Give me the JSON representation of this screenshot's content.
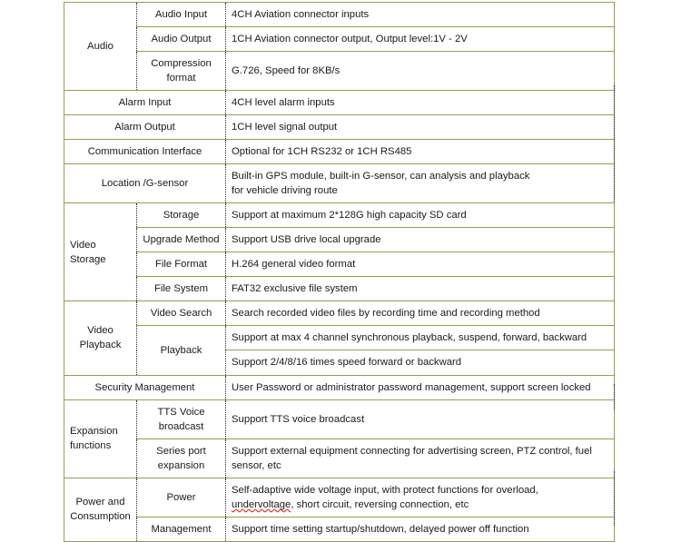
{
  "document": {
    "title": "Device Specification Table",
    "type": "specification-table"
  },
  "table": {
    "border_color": "#9a9a5e",
    "divider_color": "#2b2b2b",
    "columns": 3,
    "rows": [
      {
        "id": "audio",
        "category": "Audio",
        "category_rowspan": 3,
        "subitems": [
          {
            "label": "Audio Input",
            "value": "4CH Aviation connector inputs"
          },
          {
            "label": "Audio Output",
            "value": "1CH Aviation connector output, Output level:1V - 2V"
          },
          {
            "label": "Compression format",
            "value": "G.726, Speed for 8KB/s"
          }
        ]
      },
      {
        "id": "alarm-input",
        "category": "Alarm Input",
        "merged": true,
        "value": "4CH level alarm inputs"
      },
      {
        "id": "alarm-output",
        "category": "Alarm Output",
        "merged": true,
        "value": "1CH level signal output"
      },
      {
        "id": "communication-interface",
        "category": "Communication Interface",
        "merged": true,
        "value": "Optional for 1CH RS232 or 1CH RS485"
      },
      {
        "id": "location-gsensor",
        "category": "Location /G-sensor",
        "merged": true,
        "value_line1": "Built-in GPS module, built-in G-sensor, can analysis and playback",
        "value_line2": "for vehicle driving route"
      },
      {
        "id": "video-storage",
        "category": "Video Storage",
        "category_rowspan": 4,
        "subitems": [
          {
            "label": "Storage",
            "value": "Support at maximum 2*128G high capacity SD card"
          },
          {
            "label": "Upgrade Method",
            "value": "Support USB drive local upgrade"
          },
          {
            "label": "File Format",
            "value": "H.264 general video format"
          },
          {
            "label": "File System",
            "value": "FAT32 exclusive file system"
          }
        ]
      },
      {
        "id": "video-playback",
        "category": "Video Playback",
        "category_rowspan": 3,
        "subitems": [
          {
            "label": "Video Search",
            "value": "Search recorded video files by recording time and recording method"
          },
          {
            "label": "Playback",
            "value": "Support at max 4 channel synchronous playback, suspend, forward, backward"
          },
          {
            "label": "",
            "value": "Support 2/4/8/16 times speed forward or backward"
          }
        ]
      },
      {
        "id": "security-management",
        "category": "Security Management",
        "merged": true,
        "value": "User Password or administrator password management, support screen locked"
      },
      {
        "id": "expansion-functions",
        "category": "Expansion functions",
        "category_rowspan": 2,
        "subitems": [
          {
            "label": "TTS Voice broadcast",
            "value": "Support TTS voice broadcast"
          },
          {
            "label": "Series port expansion",
            "value_line1": "Support external equipment connecting for advertising screen, PTZ control, fuel",
            "value_line2": "sensor, etc"
          }
        ]
      },
      {
        "id": "power-consumption",
        "category": "Power and Consumption",
        "category_rowspan": 2,
        "subitems": [
          {
            "label": "Power",
            "value_line1": "Self-adaptive wide voltage input, with protect functions for overload,",
            "value_line2_a": "undervoltage",
            "value_line2_b": ", short circuit, reversing connection, etc"
          },
          {
            "label": "Management",
            "value": "Support time setting startup/shutdown, delayed power off function"
          }
        ]
      }
    ]
  }
}
